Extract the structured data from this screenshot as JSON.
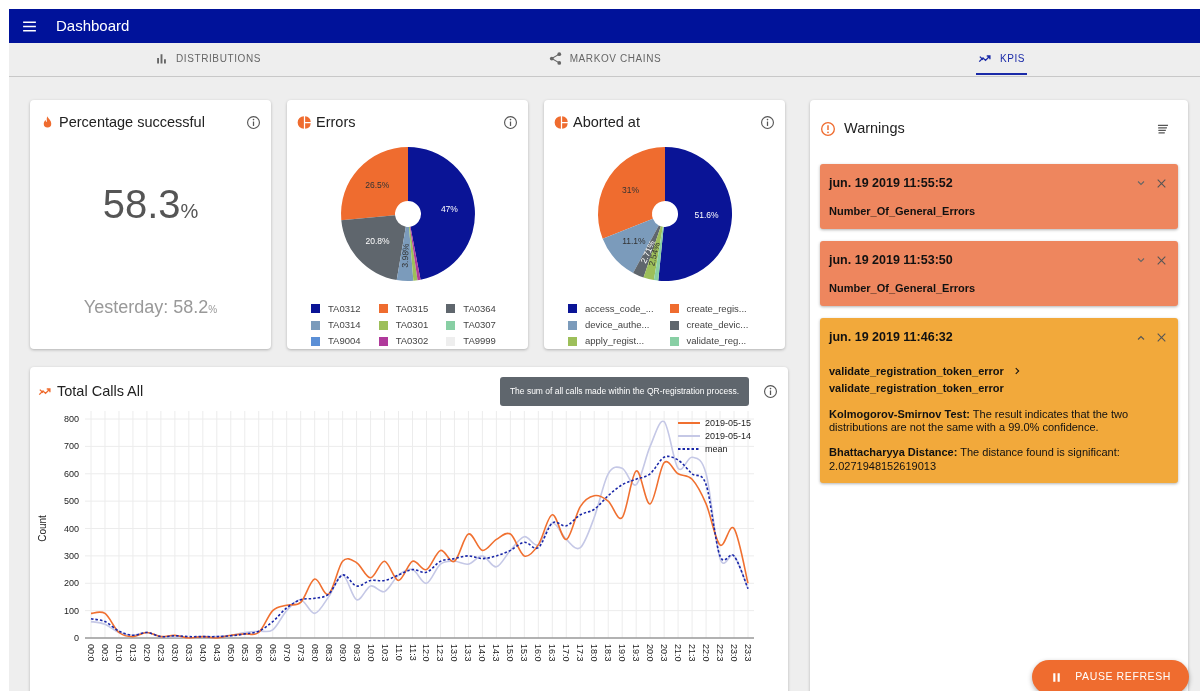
{
  "app_bar": {
    "title": "Dashboard"
  },
  "tabs": [
    {
      "label": "DISTRIBUTIONS",
      "selected": false
    },
    {
      "label": "MARKOV CHAINS",
      "selected": false
    },
    {
      "label": "KPIS",
      "selected": true
    }
  ],
  "kpi_card": {
    "title": "Percentage successful",
    "value": "58.3",
    "unit": "%",
    "yesterday": "Yesterday: 58.2",
    "yesterday_unit": "%"
  },
  "pie_cards": [
    {
      "title": "Errors",
      "chart_data": {
        "type": "donut",
        "categories": [
          "TA0312",
          "TA0315",
          "TA0364",
          "TA0314",
          "TA0301",
          "TA0307",
          "TA9004",
          "TA0302",
          "TA9999"
        ],
        "values": [
          47,
          26.5,
          20.8,
          3.98,
          1,
          0,
          0,
          0.72,
          0
        ],
        "value_labels": [
          "47%",
          "26.5%",
          "20.8%",
          "3.98%",
          null,
          null,
          null,
          null,
          null
        ],
        "colors": [
          "#0a1496",
          "#ef6c2f",
          "#5f666d",
          "#7b9bbb",
          "#9dbf5a",
          "#88cfa4",
          "#5b8fd6",
          "#b03a9b",
          "#eeeeee"
        ]
      }
    },
    {
      "title": "Aborted at",
      "chart_data": {
        "type": "donut",
        "categories": [
          "access_code_...",
          "create_regis...",
          "device_authe...",
          "create_devic...",
          "apply_regist...",
          "validate_reg..."
        ],
        "values": [
          51.6,
          31,
          11.1,
          2.71,
          2.54,
          1.05
        ],
        "value_labels": [
          "51.6%",
          "31%",
          "11.1%",
          "2.71%",
          "2.54%",
          null
        ],
        "colors": [
          "#0a1496",
          "#ef6c2f",
          "#7b9bbb",
          "#5f666d",
          "#9dbf5a",
          "#88cfa4"
        ]
      }
    }
  ],
  "calls_card": {
    "title": "Total Calls All",
    "tooltip": "The sum of all calls made within the QR-registration process.",
    "chart_data": {
      "type": "line",
      "ylabel": "Count",
      "ylim": [
        0,
        800
      ],
      "yticks": [
        0,
        100,
        200,
        300,
        400,
        500,
        600,
        700,
        800
      ],
      "grid": true,
      "legend": "top-right",
      "categories": [
        "00:0",
        "00:3",
        "01:0",
        "01:3",
        "02:0",
        "02:3",
        "03:0",
        "03:3",
        "04:0",
        "04:3",
        "05:0",
        "05:3",
        "06:0",
        "06:3",
        "07:0",
        "07:3",
        "08:0",
        "08:3",
        "09:0",
        "09:3",
        "10:0",
        "10:3",
        "11:0",
        "11:3",
        "12:0",
        "12:3",
        "13:0",
        "13:3",
        "14:0",
        "14:3",
        "15:0",
        "15:3",
        "16:0",
        "16:3",
        "17:0",
        "17:3",
        "18:0",
        "18:3",
        "19:0",
        "19:3",
        "20:0",
        "20:3",
        "21:0",
        "21:3",
        "22:0",
        "22:3",
        "23:0",
        "23:3"
      ],
      "series": [
        {
          "name": "2019-05-15",
          "color": "#f07030",
          "line_style": "solid",
          "values": [
            90,
            90,
            20,
            5,
            20,
            5,
            10,
            0,
            5,
            0,
            10,
            15,
            20,
            100,
            120,
            130,
            215,
            160,
            280,
            275,
            220,
            280,
            210,
            280,
            250,
            320,
            280,
            380,
            320,
            360,
            380,
            300,
            340,
            450,
            360,
            480,
            520,
            500,
            440,
            610,
            490,
            640,
            600,
            580,
            490,
            340,
            400,
            200
          ]
        },
        {
          "name": "2019-05-14",
          "color": "#c5c8e6",
          "line_style": "solid",
          "values": [
            60,
            50,
            20,
            10,
            20,
            5,
            5,
            0,
            5,
            5,
            10,
            20,
            25,
            30,
            100,
            140,
            90,
            150,
            230,
            140,
            190,
            170,
            230,
            250,
            200,
            270,
            280,
            270,
            300,
            260,
            320,
            370,
            340,
            420,
            360,
            330,
            440,
            600,
            620,
            560,
            700,
            790,
            620,
            660,
            600,
            290,
            300,
            180
          ]
        },
        {
          "name": "mean",
          "color": "#1a27a8",
          "line_style": "dotted",
          "values": [
            70,
            60,
            25,
            10,
            20,
            5,
            8,
            5,
            5,
            5,
            8,
            15,
            25,
            60,
            110,
            140,
            145,
            160,
            230,
            190,
            210,
            210,
            230,
            250,
            240,
            280,
            290,
            300,
            290,
            300,
            320,
            350,
            330,
            420,
            410,
            450,
            470,
            520,
            560,
            580,
            600,
            660,
            650,
            600,
            560,
            300,
            300,
            180
          ]
        }
      ]
    }
  },
  "warnings": {
    "title": "Warnings",
    "alerts": [
      {
        "kind": "error",
        "time": "jun. 19 2019 11:55:52",
        "name": "Number_Of_General_Errors",
        "expanded": false
      },
      {
        "kind": "error",
        "time": "jun. 19 2019 11:53:50",
        "name": "Number_Of_General_Errors",
        "expanded": false
      },
      {
        "kind": "warning",
        "time": "jun. 19 2019 11:46:32",
        "expanded": true,
        "transition_from": "validate_registration_token_error",
        "transition_to": "validate_registration_token_error",
        "details": [
          "**Kolmogorov-Smirnov Test:** The result indicates that the two distributions are not the same with a 99.0% confidence.",
          "**Bhattacharyya Distance:** The distance found is significant: 2.0271948152619013"
        ]
      }
    ]
  },
  "refresh_button": {
    "label": "PAUSE REFRESH"
  }
}
